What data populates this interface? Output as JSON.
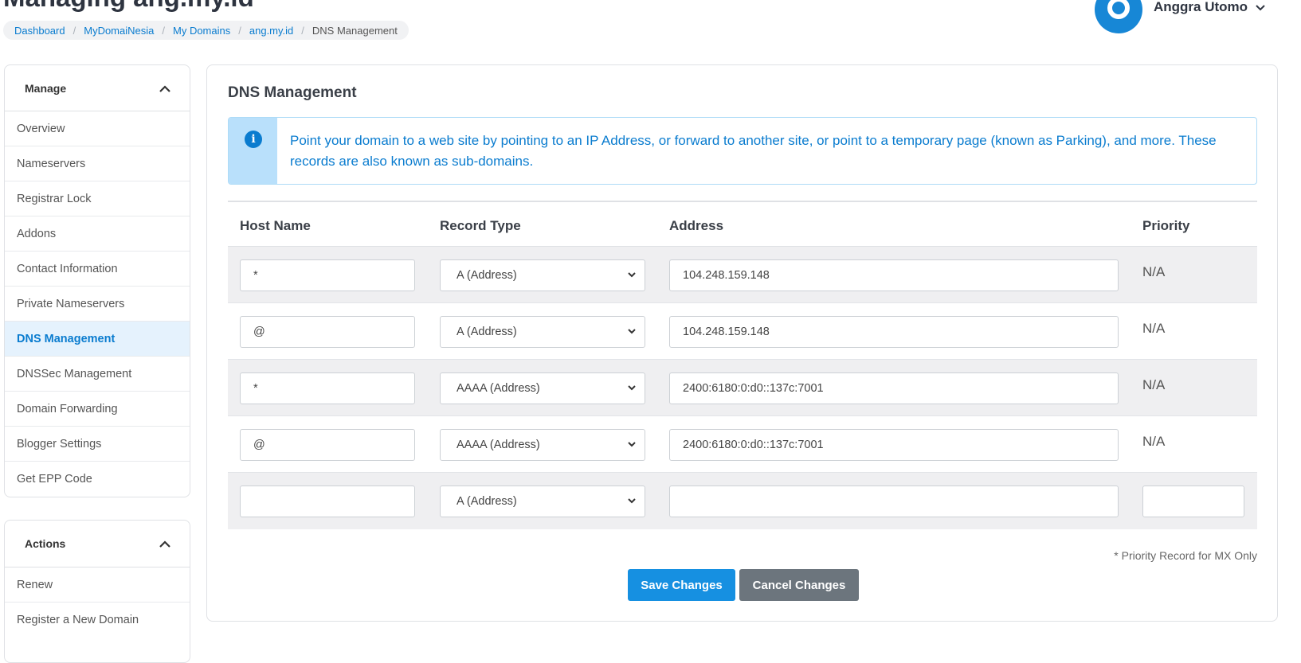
{
  "page": {
    "title": "Managing ang.my.id"
  },
  "breadcrumb": [
    "Dashboard",
    "MyDomaiNesia",
    "My Domains",
    "ang.my.id",
    "DNS Management"
  ],
  "user": {
    "name": "Anggra Utomo"
  },
  "sidebar": {
    "manage": {
      "title": "Manage",
      "items": [
        {
          "label": "Overview"
        },
        {
          "label": "Nameservers"
        },
        {
          "label": "Registrar Lock"
        },
        {
          "label": "Addons"
        },
        {
          "label": "Contact Information"
        },
        {
          "label": "Private Nameservers"
        },
        {
          "label": "DNS Management",
          "active": true
        },
        {
          "label": "DNSSec Management"
        },
        {
          "label": "Domain Forwarding"
        },
        {
          "label": "Blogger Settings"
        },
        {
          "label": "Get EPP Code"
        }
      ]
    },
    "actions": {
      "title": "Actions",
      "items": [
        {
          "label": "Renew"
        },
        {
          "label": "Register a New Domain"
        }
      ]
    }
  },
  "main": {
    "title": "DNS Management",
    "info": "Point your domain to a web site by pointing to an IP Address, or forward to another site, or point to a temporary page (known as Parking), and more. These records are also known as sub-domains.",
    "columns": {
      "host": "Host Name",
      "type": "Record Type",
      "address": "Address",
      "priority": "Priority"
    },
    "records": [
      {
        "host": "*",
        "type": "A (Address)",
        "address": "104.248.159.148",
        "priority": "N/A"
      },
      {
        "host": "@",
        "type": "A (Address)",
        "address": "104.248.159.148",
        "priority": "N/A"
      },
      {
        "host": "*",
        "type": "AAAA (Address)",
        "address": "2400:6180:0:d0::137c:7001",
        "priority": "N/A"
      },
      {
        "host": "@",
        "type": "AAAA (Address)",
        "address": "2400:6180:0:d0::137c:7001",
        "priority": "N/A"
      },
      {
        "host": "",
        "type": "A (Address)",
        "address": "",
        "priority": ""
      }
    ],
    "note": "* Priority Record for MX Only",
    "save_label": "Save Changes",
    "cancel_label": "Cancel Changes"
  },
  "colors": {
    "accent": "#0a7ccf",
    "button_primary": "#1690e1",
    "button_secondary": "#6c757d",
    "info_bg": "#b9e0fb"
  }
}
